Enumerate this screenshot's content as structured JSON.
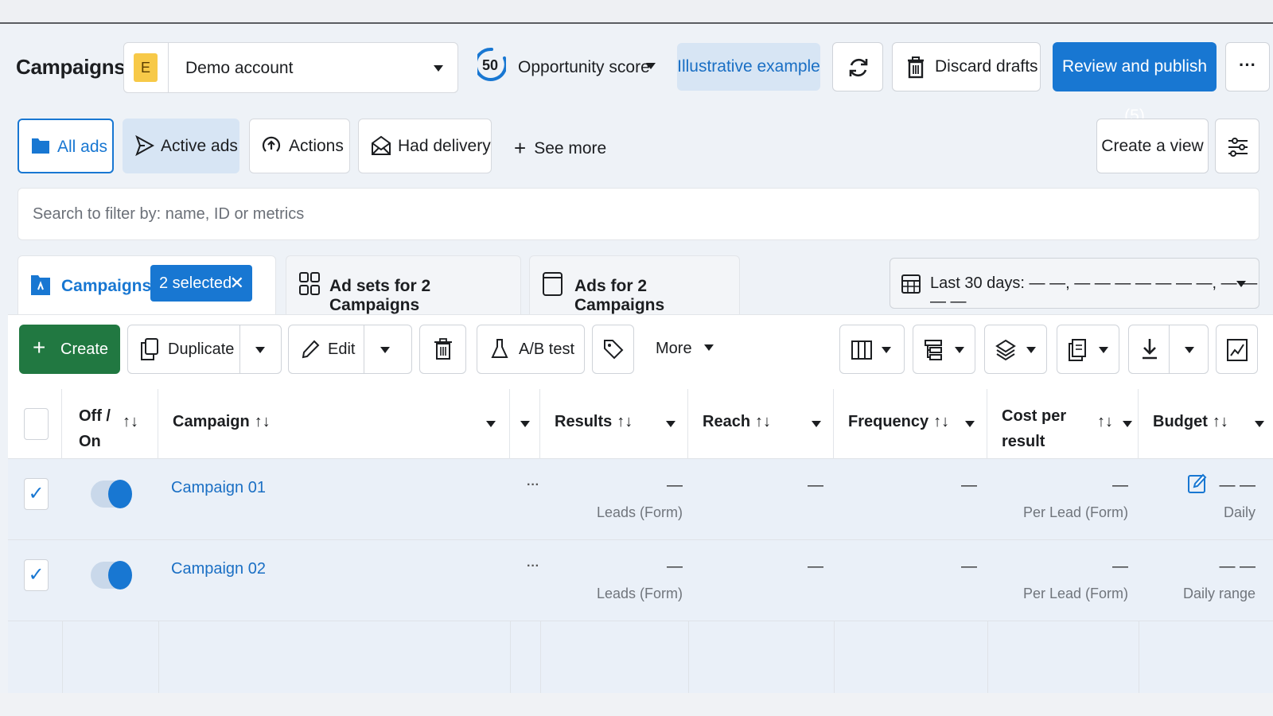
{
  "header": {
    "title": "Campaigns",
    "account_badge": "E",
    "account_name": "Demo account",
    "opportunity_score": "50",
    "opportunity_label": "Opportunity score",
    "illustrative": "Illustrative example",
    "discard_label": "Discard drafts",
    "publish_label": "Review and publish (5)",
    "more_label": "···"
  },
  "filter_tabs": {
    "all_ads": "All ads",
    "active_ads": "Active ads",
    "actions": "Actions",
    "had_delivery": "Had delivery",
    "see_more": "See more",
    "create_view": "Create a view"
  },
  "search": {
    "placeholder": "Search to filter by: name, ID or metrics"
  },
  "level_tabs": {
    "campaigns": "Campaigns",
    "selected_chip": "2 selected",
    "ad_sets": "Ad sets for 2 Campaigns",
    "ads": "Ads for 2 Campaigns",
    "date_range": "Last 30 days: — —, — — — — — — —, — — — —"
  },
  "toolbar": {
    "create": "Create",
    "duplicate": "Duplicate",
    "edit": "Edit",
    "ab_test": "A/B test",
    "more": "More"
  },
  "table": {
    "columns": {
      "off_on_line1": "Off /",
      "off_on_line2": "On",
      "campaign": "Campaign",
      "results": "Results",
      "reach": "Reach",
      "frequency": "Frequency",
      "cost_line1": "Cost per",
      "cost_line2": "result",
      "budget": "Budget",
      "sort_icon": "↑↓"
    },
    "rows": [
      {
        "name": "Campaign 01",
        "checked": "✓",
        "results": "—",
        "results_sub": "Leads (Form)",
        "reach": "—",
        "frequency": "—",
        "cost": "—",
        "cost_sub": "Per Lead (Form)",
        "budget": "— —",
        "budget_sub": "Daily"
      },
      {
        "name": "Campaign 02",
        "checked": "✓",
        "results": "—",
        "results_sub": "Leads (Form)",
        "reach": "—",
        "frequency": "—",
        "cost": "—",
        "cost_sub": "Per Lead (Form)",
        "budget": "— —",
        "budget_sub": "Daily range"
      }
    ],
    "row_menu": "···"
  },
  "colors": {
    "accent": "#1877d2",
    "create_green": "#217841",
    "account_badge": "#f7c948"
  }
}
